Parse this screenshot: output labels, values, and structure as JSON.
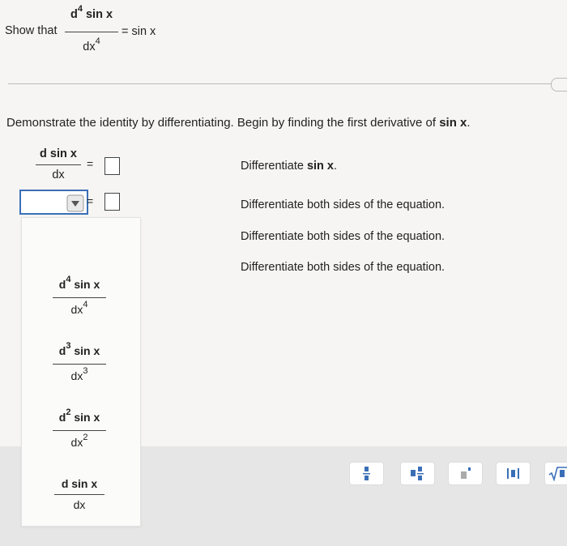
{
  "header": {
    "lead": "Show that",
    "numerator": "sin x",
    "numerator_d": "d",
    "numerator_exp": "4",
    "denominator": "dx",
    "denominator_exp": "4",
    "rhs": "= sin x"
  },
  "instruction": {
    "text": "Demonstrate the identity by differentiating. Begin by finding the first derivative of ",
    "bold": "sin x",
    "end": "."
  },
  "steps": [
    {
      "label": "Differentiate ",
      "bold": "sin x",
      "end": "."
    },
    {
      "label": "Differentiate both sides of the equation."
    },
    {
      "label": "Differentiate both sides of the equation."
    },
    {
      "label": "Differentiate both sides of the equation."
    }
  ],
  "step1": {
    "num": "d sin x",
    "den": "dx",
    "equals": "="
  },
  "step2": {
    "equals": "="
  },
  "dropdown": {
    "options": [
      {
        "d": "d",
        "exp": "4",
        "num": "sin x",
        "den": "dx",
        "den_exp": "4"
      },
      {
        "d": "d",
        "exp": "3",
        "num": "sin x",
        "den": "dx",
        "den_exp": "3"
      },
      {
        "d": "d",
        "exp": "2",
        "num": "sin x",
        "den": "dx",
        "den_exp": "2"
      },
      {
        "d": "",
        "exp": "",
        "num": "d sin x",
        "den": "dx",
        "den_exp": ""
      }
    ]
  },
  "toolbar": {
    "tools": [
      "fraction-tool",
      "mixed-number-tool",
      "exponent-tool",
      "absolute-value-tool",
      "sqrt-tool"
    ],
    "accent": "#3a6fb7"
  }
}
